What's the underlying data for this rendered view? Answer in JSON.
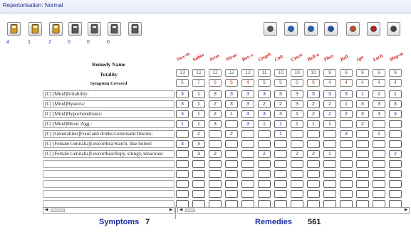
{
  "window": {
    "title": "Repertorisation: Normal"
  },
  "toolbar": {
    "left_buttons": [
      {
        "name": "rubric-set-1-button",
        "icon": "book-icon",
        "color": "#d99b1c",
        "count": "4"
      },
      {
        "name": "rubric-set-2-button",
        "icon": "book-icon",
        "color": "#d99b1c",
        "count": "1"
      },
      {
        "name": "rubric-set-3-button",
        "icon": "book-icon",
        "color": "#d99b1c",
        "count": "2"
      },
      {
        "name": "rubric-set-4-button",
        "icon": "book-icon",
        "color": "#5a5a5a",
        "count": "0"
      },
      {
        "name": "rubric-set-5-button",
        "icon": "book-icon",
        "color": "#5a5a5a",
        "count": "0"
      },
      {
        "name": "rubric-set-6-button",
        "icon": "book-icon",
        "color": "#5a5a5a",
        "count": "0"
      },
      {
        "name": "copy-button",
        "icon": "copy-icon",
        "color": "#5a5a5a",
        "count": ""
      }
    ],
    "right_buttons": [
      {
        "name": "report-button",
        "icon": "document-icon",
        "color": "#555555"
      },
      {
        "name": "filter-button",
        "icon": "arrow-icon",
        "color": "#1c5fb5"
      },
      {
        "name": "analysis-button",
        "icon": "globe-icon",
        "color": "#1c5fb5"
      },
      {
        "name": "search-remedy-button",
        "icon": "magnifier-icon",
        "color": "#1c4fb0"
      },
      {
        "name": "export-button",
        "icon": "page-icon",
        "color": "#c04a2a"
      },
      {
        "name": "print-button",
        "icon": "list-icon",
        "color": "#b02020"
      },
      {
        "name": "settings-button",
        "icon": "pen-icon",
        "color": "#444444"
      }
    ]
  },
  "grid": {
    "remedy_name_label": "Remedy Name",
    "totality_label": "Totality",
    "symptom_covered_label": "Symptom Covered",
    "remedies": [
      "Nux-m",
      "Sabin",
      "Acon",
      "Nit-ac",
      "Bov-x",
      "Graph",
      "Calc",
      "Caust",
      "Bell-a",
      "Phos",
      "Bell",
      "Ign",
      "Lach",
      "Mag-m"
    ],
    "totality": [
      "13",
      "12",
      "12",
      "12",
      "12",
      "11",
      "10",
      "10",
      "10",
      "9",
      "9",
      "9",
      "9",
      "9"
    ],
    "covered": [
      "5",
      "7",
      "5",
      "5",
      "4",
      "5",
      "5",
      "5",
      "5",
      "4",
      "4",
      "4",
      "4",
      "4"
    ],
    "rows": [
      {
        "label": "[C] [Mind]Irritability:",
        "cells": [
          "3",
          "1",
          "3",
          "3",
          "3",
          "3",
          "3",
          "3",
          "3",
          "3",
          "3",
          "1",
          "2",
          "1"
        ]
      },
      {
        "label": "[C] [Mind]Hysteria:",
        "cells": [
          "3",
          "1",
          "2",
          "3",
          "3",
          "2",
          "2",
          "3",
          "2",
          "2",
          "1",
          "3",
          "3",
          "3"
        ]
      },
      {
        "label": "[C] [Mind]Hypochondriasis:",
        "cells": [
          "3",
          "1",
          "2",
          "1",
          "3",
          "3",
          "3",
          "1",
          "2",
          "2",
          "2",
          "3",
          "3",
          "3"
        ]
      },
      {
        "label": "[C] [Mind]Music:Agg.:",
        "cells": [
          "1",
          "1",
          "3",
          "",
          "3",
          "1",
          "1",
          "1",
          "1",
          "1",
          "",
          "2",
          "",
          ""
        ]
      },
      {
        "label": "[C] [Generalities]Food and drinks:Lemonade:Desires:",
        "cells": [
          "",
          "2",
          "",
          "2",
          "",
          "",
          "1",
          "",
          "",
          "",
          "3",
          "",
          "1",
          ""
        ]
      },
      {
        "label": "[C] [Female Genitalia]Leucorrhea:Starch, like boiled:",
        "cells": [
          "3",
          "3",
          "",
          "",
          "",
          "",
          "",
          "",
          "",
          "",
          "",
          "",
          "",
          ""
        ]
      },
      {
        "label": "[C] [Female Genitalia]Leucorrhea:Ropy, stringy, tenacious:",
        "cells": [
          "",
          "3",
          "2",
          "",
          "",
          "2",
          "",
          "2",
          "2",
          "1",
          "",
          "",
          "",
          "2"
        ]
      },
      {
        "label": "",
        "cells": [
          "",
          "",
          "",
          "",
          "",
          "",
          "",
          "",
          "",
          "",
          "",
          "",
          "",
          ""
        ]
      },
      {
        "label": "",
        "cells": [
          "",
          "",
          "",
          "",
          "",
          "",
          "",
          "",
          "",
          "",
          "",
          "",
          "",
          ""
        ]
      },
      {
        "label": "",
        "cells": [
          "",
          "",
          "",
          "",
          "",
          "",
          "",
          "",
          "",
          "",
          "",
          "",
          "",
          ""
        ]
      },
      {
        "label": "",
        "cells": [
          "",
          "",
          "",
          "",
          "",
          "",
          "",
          "",
          "",
          "",
          "",
          "",
          "",
          ""
        ]
      },
      {
        "label": "",
        "cells": [
          "",
          "",
          "",
          "",
          "",
          "",
          "",
          "",
          "",
          "",
          "",
          "",
          "",
          ""
        ]
      }
    ]
  },
  "footer": {
    "symptoms_label": "Symptoms",
    "symptoms_count": "7",
    "remedies_label": "Remedies",
    "remedies_count": "561"
  }
}
